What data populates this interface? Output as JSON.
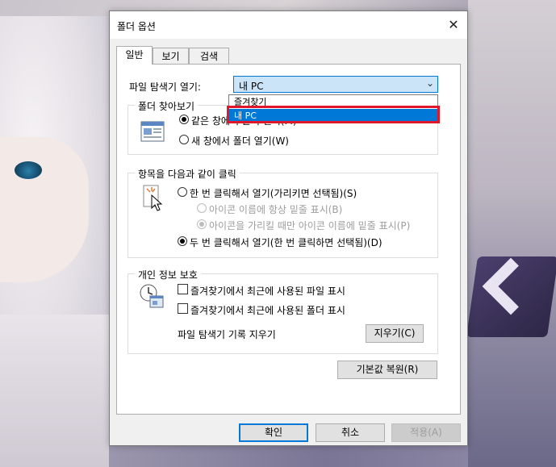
{
  "dialog": {
    "title": "폴더 옵션",
    "close_icon": "✕"
  },
  "tabs": [
    {
      "label": "일반",
      "active": true
    },
    {
      "label": "보기",
      "active": false
    },
    {
      "label": "검색",
      "active": false
    }
  ],
  "open_explorer": {
    "label": "파일 탐색기 열기:",
    "value": "내 PC",
    "options": [
      "즐겨찾기",
      "내 PC"
    ],
    "selected_option": "내 PC",
    "highlight_color": "#e0162b"
  },
  "browse_folders": {
    "title": "폴더 찾아보기",
    "options": [
      {
        "label": "같은 창에서 폴더 열기(M)",
        "checked": true
      },
      {
        "label": "새 창에서 폴더 열기(W)",
        "checked": false
      }
    ]
  },
  "click_items": {
    "title": "항목을 다음과 같이 클릭",
    "options": [
      {
        "label": "한 번 클릭해서 열기(가리키면 선택됨)(S)",
        "checked": false,
        "enabled": true
      },
      {
        "label": "아이콘 이름에 항상 밑줄 표시(B)",
        "checked": false,
        "enabled": false
      },
      {
        "label": "아이콘을 가리킬 때만 아이콘 이름에 밑줄 표시(P)",
        "checked": true,
        "enabled": false
      },
      {
        "label": "두 번 클릭해서 열기(한 번 클릭하면 선택됨)(D)",
        "checked": true,
        "enabled": true
      }
    ]
  },
  "privacy": {
    "title": "개인 정보 보호",
    "options": [
      {
        "label": "즐겨찾기에서 최근에 사용된 파일 표시",
        "checked": false
      },
      {
        "label": "즐겨찾기에서 최근에 사용된 폴더 표시",
        "checked": false
      }
    ],
    "clear_label": "파일 탐색기 기록 지우기",
    "clear_button": "지우기(C)"
  },
  "restore_defaults": "기본값 복원(R)",
  "footer": {
    "ok": "확인",
    "cancel": "취소",
    "apply": "적용(A)"
  },
  "colors": {
    "accent": "#0078d7",
    "selection": "#cce4f7"
  }
}
